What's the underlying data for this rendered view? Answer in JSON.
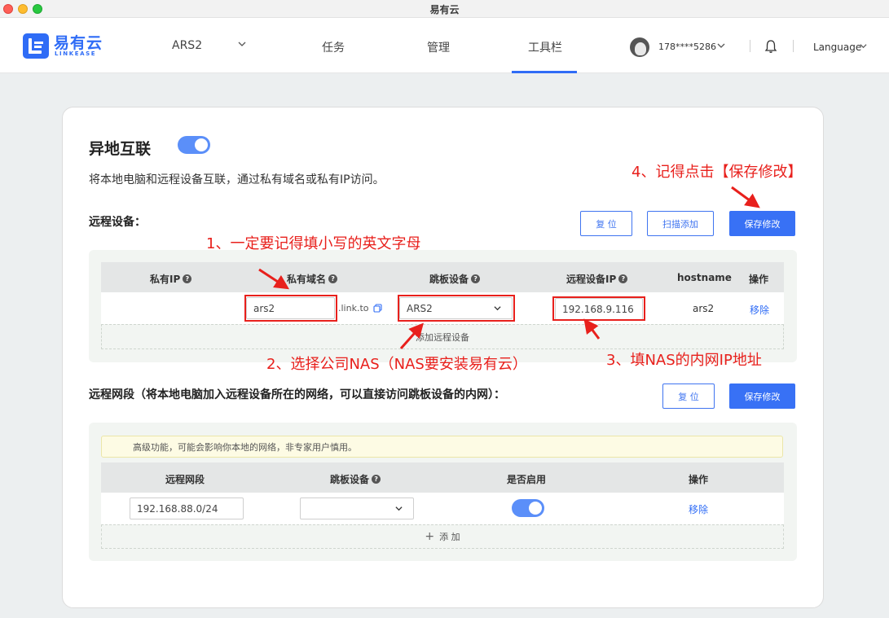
{
  "window": {
    "title": "易有云"
  },
  "header": {
    "logo_text": "易有云",
    "logo_sub": "LINKEASE",
    "nav": [
      {
        "label": "ARS2"
      },
      {
        "label": "任务"
      },
      {
        "label": "管理"
      },
      {
        "label": "工具栏",
        "active": true
      }
    ],
    "user_phone": "178****5286",
    "language": "Language"
  },
  "page": {
    "title": "异地互联",
    "toggle_on": true,
    "description": "将本地电脑和远程设备互联，通过私有域名或私有IP访问。",
    "remote_devices": {
      "label": "远程设备：",
      "reset_button": "复 位",
      "scan_button": "扫描添加",
      "save_button": "保存修改",
      "columns": [
        "私有IP",
        "私有域名",
        "跳板设备",
        "远程设备IP",
        "hostname",
        "操作"
      ],
      "rows": [
        {
          "private_ip": "",
          "domain": "ars2",
          "domain_suffix": ".link.to",
          "jump_device": "ARS2",
          "remote_ip": "192.168.9.116",
          "hostname": "ars2",
          "action": "移除"
        }
      ],
      "add_label": "添加远程设备"
    },
    "remote_segment": {
      "label": "远程网段（将本地电脑加入远程设备所在的网络，可以直接访问跳板设备的内网）：",
      "reset_button": "复 位",
      "save_button": "保存修改",
      "notice": "高级功能，可能会影响你本地的网络，非专家用户慎用。",
      "columns": [
        "远程网段",
        "跳板设备",
        "是否启用",
        "操作"
      ],
      "rows": [
        {
          "segment": "192.168.88.0/24",
          "jump_device": "",
          "enabled": true,
          "action": "移除"
        }
      ],
      "add_label": "添 加"
    }
  },
  "annotations": {
    "a1": "1、一定要记得填小写的英文字母",
    "a2": "2、选择公司NAS（NAS要安装易有云）",
    "a3": "3、填NAS的内网IP地址",
    "a4": "4、记得点击【保存修改】",
    "color": "#e8201c"
  },
  "colors": {
    "accent": "#2f6cf6",
    "primary_button": "#3871f5"
  }
}
